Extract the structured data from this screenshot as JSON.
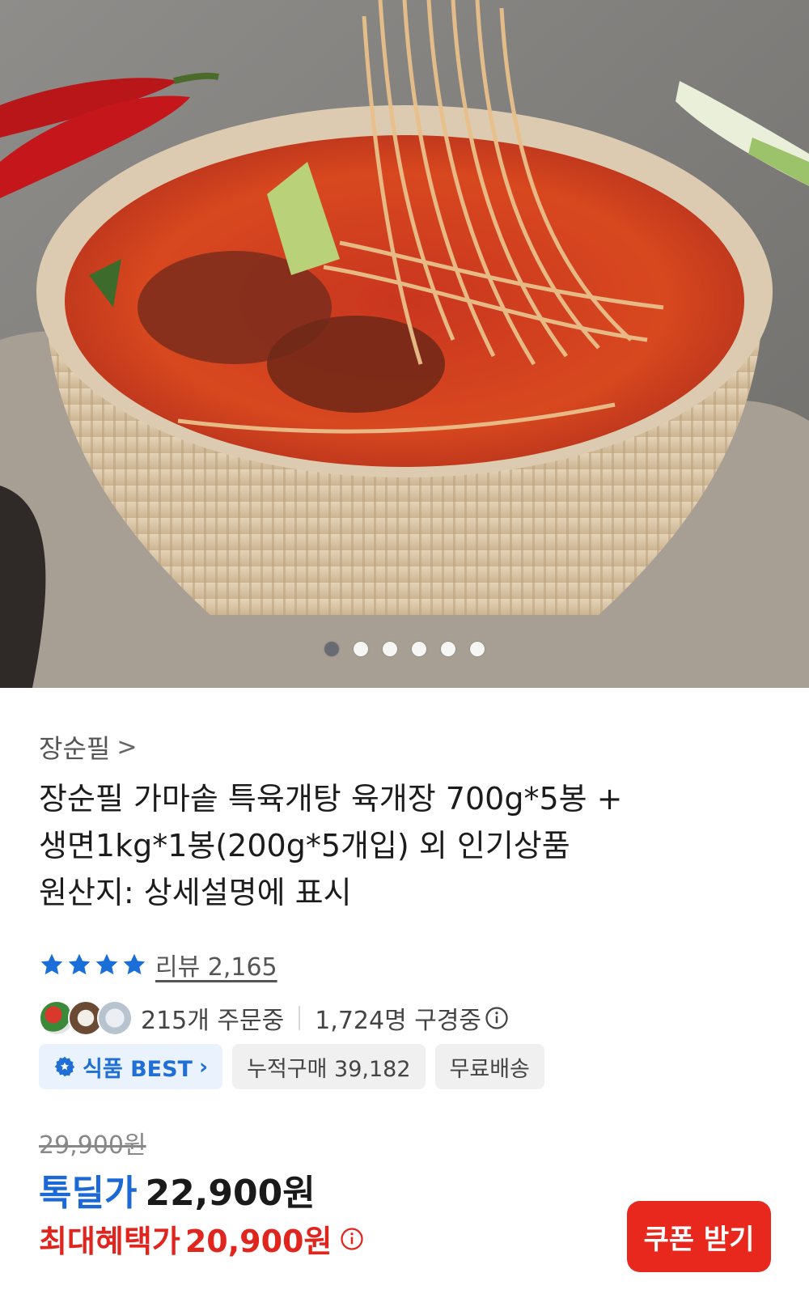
{
  "hero": {
    "image_description_icon": "bowl-of-yukgaejang-photo",
    "carousel_total": 6,
    "carousel_active_index": 0
  },
  "seller": {
    "name": "장순필",
    "chevron": ">"
  },
  "product": {
    "title_line1": "장순필 가마솥 특육개탕 육개장 700g*5봉 +",
    "title_line2": "생면1kg*1봉(200g*5개입) 외 인기상품",
    "origin": "원산지: 상세설명에 표시"
  },
  "rating": {
    "stars": 4,
    "review_text": "리뷰 2,165"
  },
  "activity": {
    "ordering": "215개 주문중",
    "browsing": "1,724명 구경중"
  },
  "badges": {
    "best": "식품 BEST",
    "cumulative": "누적구매 39,182",
    "shipping": "무료배송"
  },
  "price": {
    "original": "29,900원",
    "deal_label": "톡딜가",
    "deal_price": "22,900원",
    "max_label": "최대혜택가",
    "max_price": "20,900원"
  },
  "coupon_button": "쿠폰 받기",
  "colors": {
    "accent_blue": "#1b69d6",
    "accent_red": "#e8271d",
    "star_blue": "#1a6ed8"
  }
}
